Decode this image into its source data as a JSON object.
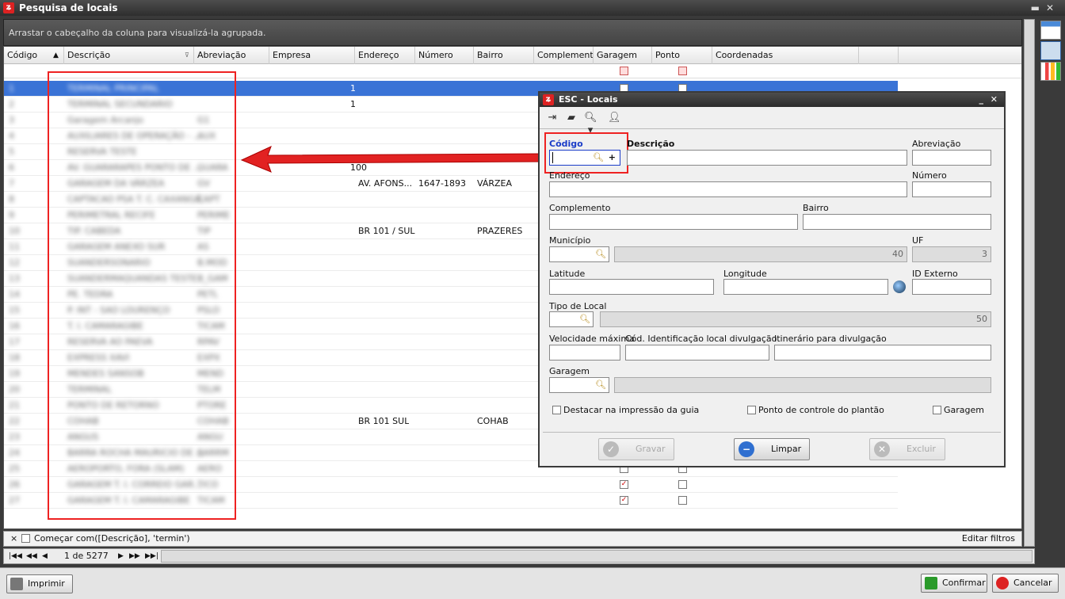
{
  "window": {
    "title": "Pesquisa de locais"
  },
  "group_panel": {
    "hint": "Arrastar o cabeçalho da coluna para visualizá-la agrupada."
  },
  "columns": [
    "Código",
    "Descrição",
    "Abreviação",
    "Empresa",
    "Endereço",
    "Número",
    "Bairro",
    "Complemento",
    "Garagem",
    "Ponto",
    "Coordenadas"
  ],
  "rows": [
    {
      "codigo": "1",
      "descricao": "TERMINAL PRINCIPAL",
      "abrev": "",
      "empresa": "1",
      "endereco": "",
      "numero": "",
      "bairro": "",
      "garagem": false,
      "ponto": false,
      "selected": true
    },
    {
      "codigo": "2",
      "descricao": "TERMINAL SECUNDARIO",
      "abrev": "",
      "empresa": "1",
      "endereco": "",
      "numero": "",
      "bairro": ""
    },
    {
      "codigo": "3",
      "descricao": "Garagem Arcanjo",
      "abrev": "G1",
      "empresa": "",
      "endereco": "",
      "numero": "",
      "bairro": ""
    },
    {
      "codigo": "4",
      "descricao": "AUXILIARES DE OPERAÇÃO - ...",
      "abrev": "AUX",
      "empresa": "",
      "endereco": "",
      "numero": "",
      "bairro": ""
    },
    {
      "codigo": "5",
      "descricao": "RESERVA TESTE",
      "abrev": "",
      "empresa": "",
      "endereco": "",
      "numero": "",
      "bairro": ""
    },
    {
      "codigo": "6",
      "descricao": "AV. GUARARAPES PONTO DE ...",
      "abrev": "GUARA",
      "empresa": "100",
      "endereco": "",
      "numero": "",
      "bairro": ""
    },
    {
      "codigo": "7",
      "descricao": "GARAGEM DA VÁRZEA",
      "abrev": "GV",
      "empresa": "",
      "endereco": "AV. AFONS...",
      "numero": "1647-1893",
      "bairro": "VÁRZEA"
    },
    {
      "codigo": "8",
      "descricao": "CAPTACAO PSA T. C. CAXANGÁ",
      "abrev": "CAPT",
      "empresa": "",
      "endereco": "",
      "numero": "",
      "bairro": ""
    },
    {
      "codigo": "9",
      "descricao": "PERIMETRAL RECIFE",
      "abrev": "PERIME",
      "empresa": "",
      "endereco": "",
      "numero": "",
      "bairro": ""
    },
    {
      "codigo": "10",
      "descricao": "TIP. CABEDA",
      "abrev": "TIP",
      "empresa": "",
      "endereco": "BR 101 / SUL",
      "numero": "",
      "bairro": "PRAZERES"
    },
    {
      "codigo": "11",
      "descricao": "GARAGEM ANEXO SUR",
      "abrev": "AS",
      "empresa": "",
      "endereco": "",
      "numero": "",
      "bairro": ""
    },
    {
      "codigo": "12",
      "descricao": "SUANDERSONARIO",
      "abrev": "B.MOD",
      "empresa": "",
      "endereco": "",
      "numero": "",
      "bairro": ""
    },
    {
      "codigo": "13",
      "descricao": "SUANDERMAQUANDAS TESTE",
      "abrev": "B_GAM",
      "empresa": "",
      "endereco": "",
      "numero": "",
      "bairro": ""
    },
    {
      "codigo": "14",
      "descricao": "PE. TEDRA",
      "abrev": "PETL",
      "empresa": "",
      "endereco": "",
      "numero": "",
      "bairro": ""
    },
    {
      "codigo": "15",
      "descricao": "P. INT - SAO LOURENÇO",
      "abrev": "PSLO",
      "empresa": "",
      "endereco": "",
      "numero": "",
      "bairro": ""
    },
    {
      "codigo": "16",
      "descricao": "T. I. CAMARAGIBE",
      "abrev": "TICAM",
      "empresa": "",
      "endereco": "",
      "numero": "",
      "bairro": ""
    },
    {
      "codigo": "17",
      "descricao": "RESERVA AO PAEVA",
      "abrev": "RPAV",
      "empresa": "",
      "endereco": "",
      "numero": "",
      "bairro": ""
    },
    {
      "codigo": "18",
      "descricao": "EXPRESS XAVI",
      "abrev": "EXPX",
      "empresa": "",
      "endereco": "",
      "numero": "",
      "bairro": ""
    },
    {
      "codigo": "19",
      "descricao": "MENDES SANSOB",
      "abrev": "MEND",
      "empresa": "",
      "endereco": "",
      "numero": "",
      "bairro": ""
    },
    {
      "codigo": "20",
      "descricao": "TERMINAL",
      "abrev": "TELM",
      "empresa": "",
      "endereco": "",
      "numero": "",
      "bairro": ""
    },
    {
      "codigo": "21",
      "descricao": "PONTO DE RETORNO",
      "abrev": "PTORE",
      "empresa": "",
      "endereco": "",
      "numero": "",
      "bairro": ""
    },
    {
      "codigo": "22",
      "descricao": "COHAB",
      "abrev": "COHAB",
      "empresa": "",
      "endereco": "BR 101 SUL",
      "numero": "",
      "bairro": "COHAB"
    },
    {
      "codigo": "23",
      "descricao": "ANGUS",
      "abrev": "ANGU",
      "empresa": "",
      "endereco": "",
      "numero": "",
      "bairro": ""
    },
    {
      "codigo": "24",
      "descricao": "BARRA ROCHA MAURICIO DE ...",
      "abrev": "BARRM",
      "empresa": "",
      "endereco": "",
      "numero": "",
      "bairro": ""
    },
    {
      "codigo": "25",
      "descricao": "AEROPORTO, FORA (SLAM)",
      "abrev": "AERO",
      "empresa": "",
      "endereco": "",
      "numero": "",
      "bairro": "",
      "garagem": false,
      "ponto": false
    },
    {
      "codigo": "26",
      "descricao": "GARAGEM T. I. CORREIO GAR...",
      "abrev": "TICO",
      "empresa": "",
      "endereco": "",
      "numero": "",
      "bairro": "",
      "garagem": true,
      "ponto": false
    },
    {
      "codigo": "27",
      "descricao": "GARAGEM T. I. CAMARAGIBE",
      "abrev": "TICAM",
      "empresa": "",
      "endereco": "",
      "numero": "",
      "bairro": "",
      "garagem": true,
      "ponto": false
    }
  ],
  "filter_footer": {
    "close": "×",
    "text": "Começar com([Descrição], 'termin')",
    "edit": "Editar filtros"
  },
  "pager": {
    "text": "1 de 5277"
  },
  "buttons": {
    "print": "Imprimir",
    "confirm": "Confirmar",
    "cancel": "Cancelar"
  },
  "colors": {
    "accent": "#3a73d6",
    "highlight": "#e22222"
  },
  "dialog": {
    "title": "ESC - Locais",
    "labels": {
      "codigo": "Código",
      "descricao": "Descrição",
      "abreviacao": "Abreviação",
      "endereco": "Endereço",
      "numero": "Número",
      "complemento": "Complemento",
      "bairro": "Bairro",
      "municipio": "Município",
      "uf": "UF",
      "latitude": "Latitude",
      "longitude": "Longitude",
      "id_externo": "ID Externo",
      "tipo_local": "Tipo de Local",
      "velocidade": "Velocidade máxima",
      "cod_ident": "Cód. Identificação local divulgação",
      "itinerario": "Itinerário para divulgação",
      "garagem": "Garagem"
    },
    "values": {
      "municipio_len": "40",
      "uf_len": "3",
      "tipo_len": "50"
    },
    "checks": {
      "destacar": "Destacar na impressão da guia",
      "ponto": "Ponto de controle do plantão",
      "garagem": "Garagem"
    },
    "buttons": {
      "gravar": "Gravar",
      "limpar": "Limpar",
      "excluir": "Excluir"
    }
  }
}
